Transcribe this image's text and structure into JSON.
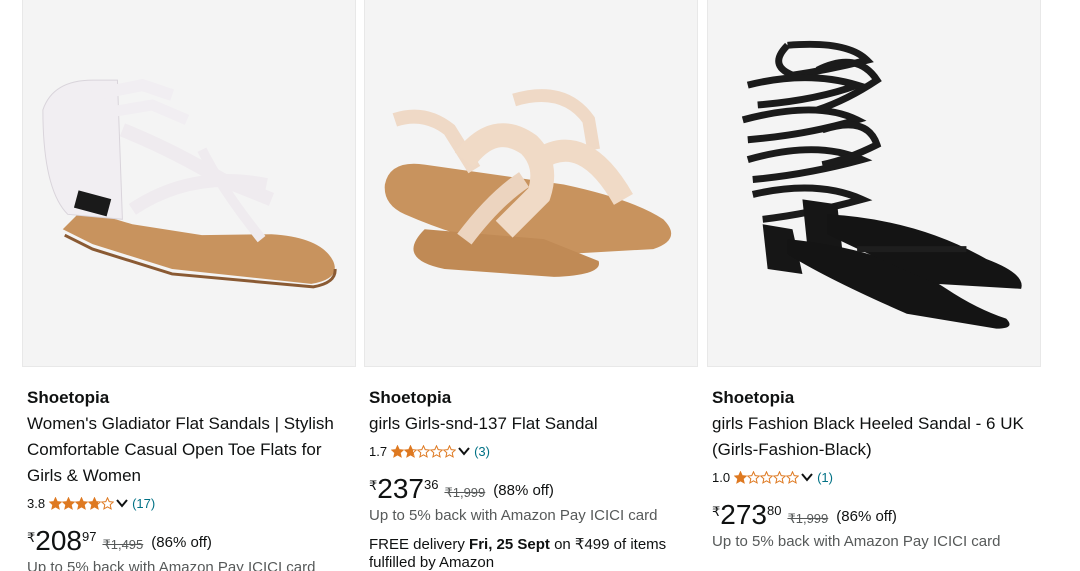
{
  "products": [
    {
      "brand": "Shoetopia",
      "title": "Women's Gladiator Flat Sandals | Stylish Comfortable Casual Open Toe Flats for Girls & Women",
      "rating": "3.8",
      "stars": 3.8,
      "review_count": "(17)",
      "currency": "₹",
      "price_whole": "208",
      "price_fraction": "97",
      "mrp": "₹1,495",
      "discount": "(86% off)",
      "cashback": "Up to 5% back with Amazon Pay ICICI card"
    },
    {
      "brand": "Shoetopia",
      "title": "girls Girls-snd-137 Flat Sandal",
      "rating": "1.7",
      "stars": 1.7,
      "review_count": "(3)",
      "currency": "₹",
      "price_whole": "237",
      "price_fraction": "36",
      "mrp": "₹1,999",
      "discount": "(88% off)",
      "cashback": "Up to 5% back with Amazon Pay ICICI card",
      "delivery_prefix": "FREE delivery",
      "delivery_date": "Fri, 25 Sept",
      "delivery_suffix": "on ₹499 of items fulfilled by Amazon"
    },
    {
      "brand": "Shoetopia",
      "title": "girls Fashion Black Heeled Sandal - 6 UK (Girls-Fashion-Black)",
      "rating": "1.0",
      "stars": 1.0,
      "review_count": "(1)",
      "currency": "₹",
      "price_whole": "273",
      "price_fraction": "80",
      "mrp": "₹1,999",
      "discount": "(86% off)",
      "cashback": "Up to 5% back with Amazon Pay ICICI card"
    }
  ],
  "colors": {
    "star": "#de7921",
    "link": "#007185",
    "muted": "#565959"
  },
  "icons": {
    "rating_dropdown": "chevron-down-icon",
    "star": "star-icon"
  }
}
